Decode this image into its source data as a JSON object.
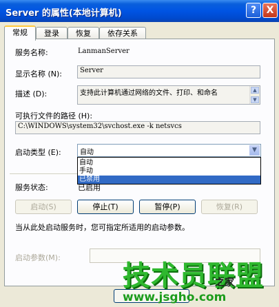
{
  "window": {
    "title": "Server 的属性(本地计算机)",
    "help_label": "?",
    "close_label": "X"
  },
  "tabs": [
    "常规",
    "登录",
    "恢复",
    "依存关系"
  ],
  "general": {
    "service_name_label": "服务名称:",
    "service_name_value": "LanmanServer",
    "display_name_label": "显示名称 (N):",
    "display_name_value": "Server",
    "description_label": "描述 (D):",
    "description_value": "支持此计算机通过网络的文件、打印、和命名",
    "exec_path_label": "可执行文件的路径 (H):",
    "exec_path_value": "C:\\WINDOWS\\system32\\svchost.exe -k netsvcs",
    "startup_type_label": "启动类型 (E):",
    "startup_type_selected": "自动",
    "startup_type_options": [
      "自动",
      "手动",
      "已禁用"
    ],
    "highlighted_option": "已禁用",
    "service_status_label": "服务状态:",
    "service_status_value": "已启用",
    "buttons": {
      "start": "启动(S)",
      "stop": "停止(T)",
      "pause": "暂停(P)",
      "resume": "恢复(R)"
    },
    "hint_text": "当从此处启动服务时，您可指定所适用的启动参数。",
    "start_params_label": "启动参数(M):",
    "start_params_value": ""
  },
  "watermark": {
    "main": "技术员联盟",
    "small": "之家",
    "url": "www.jsgho.com"
  }
}
